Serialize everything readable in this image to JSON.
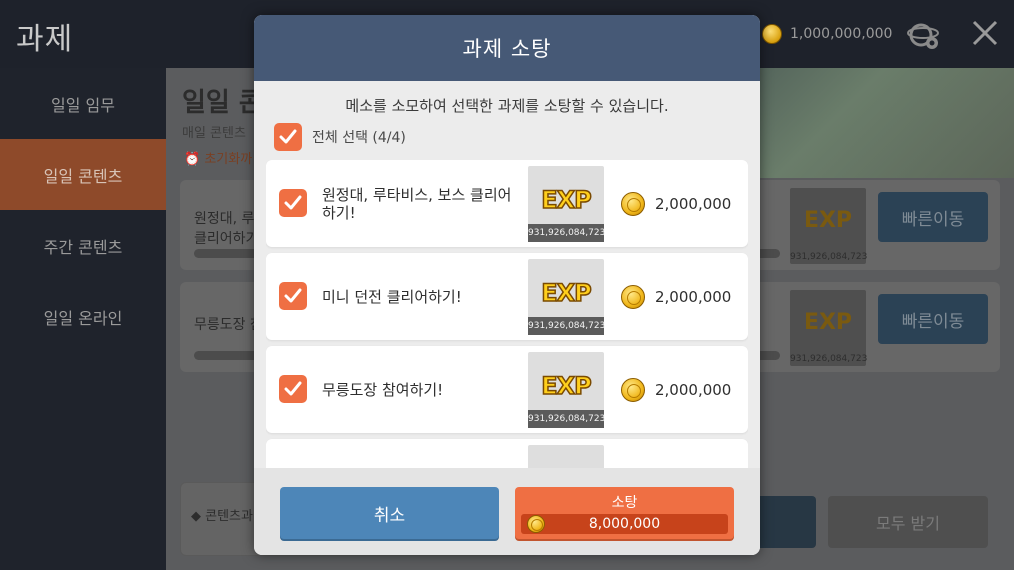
{
  "screen": {
    "title": "과제",
    "currency_amount": "1,000,000,000"
  },
  "sidebar": {
    "items": [
      {
        "label": "일일 임무"
      },
      {
        "label": "일일 콘텐츠"
      },
      {
        "label": "주간 콘텐츠"
      },
      {
        "label": "일일 온라인"
      }
    ]
  },
  "main": {
    "heading": "일일 콘",
    "subtitle": "매일 콘텐츠",
    "reset_text": "⏰ 초기화까",
    "cards": [
      {
        "text": "원정대, 루\n클리어하기",
        "exp": "931,926,084,723",
        "button": "빠른이동"
      },
      {
        "text": "무릉도장 참",
        "exp": "931,926,084,723",
        "button": "빠른이동"
      }
    ],
    "footer_label": "◆ 콘텐츠과",
    "receive_all": "모두 받기"
  },
  "modal": {
    "title": "과제 소탕",
    "description": "메소를 소모하여 선택한 과제를 소탕할 수 있습니다.",
    "select_all_label": "전체 선택 (4/4)",
    "tasks": [
      {
        "label": "원정대, 루타비스, 보스 클리어하기!",
        "exp_logo": "EXP",
        "exp_amount": "931,926,084,723",
        "cost": "2,000,000",
        "checked": true
      },
      {
        "label": "미니 던전 클리어하기!",
        "exp_logo": "EXP",
        "exp_amount": "931,926,084,723",
        "cost": "2,000,000",
        "checked": true
      },
      {
        "label": "무릉도장 참여하기!",
        "exp_logo": "EXP",
        "exp_amount": "931,926,084,723",
        "cost": "2,000,000",
        "checked": true
      },
      {
        "label": "",
        "exp_logo": "",
        "exp_amount": "",
        "cost": "",
        "checked": true
      }
    ],
    "cancel_label": "취소",
    "sweep_label": "소탕",
    "sweep_total": "8,000,000"
  },
  "colors": {
    "accent_orange": "#ef6f43",
    "header_blue": "#465976",
    "cancel_blue": "#4d86b8"
  },
  "icons": {
    "checkbox": "check-icon",
    "meso": "meso-coin-icon",
    "close": "close-icon",
    "settings": "world-settings-icon"
  }
}
